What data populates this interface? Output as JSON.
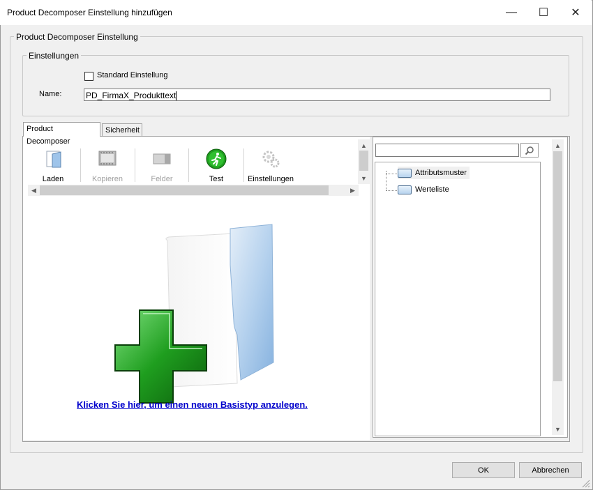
{
  "window": {
    "title": "Product Decomposer Einstellung hinzufügen",
    "minimize_glyph": "—",
    "maximize_glyph": "☐",
    "close_glyph": "✕"
  },
  "outer_group": {
    "legend": "Product Decomposer Einstellung"
  },
  "settings_group": {
    "legend": "Einstellungen",
    "standard_checkbox": {
      "label": "Standard Einstellung",
      "checked": false
    },
    "name_label": "Name:",
    "name_value": "PD_FirmaX_Produkttext"
  },
  "tabs": [
    {
      "label": "Product Decomposer",
      "active": true
    },
    {
      "label": "Sicherheit",
      "active": false
    }
  ],
  "toolbar": {
    "items": [
      {
        "label": "Laden",
        "icon": "folder-open-icon",
        "enabled": true
      },
      {
        "label": "Kopieren",
        "icon": "copy-film-icon",
        "enabled": false
      },
      {
        "label": "Felder",
        "icon": "fields-icon",
        "enabled": false
      },
      {
        "label": "Test",
        "icon": "running-man-icon",
        "enabled": true
      },
      {
        "label": "Einstellungen",
        "icon": "gears-icon",
        "enabled": true
      }
    ]
  },
  "main": {
    "create_link": "Klicken Sie hier, um einen neuen Basistyp anzulegen."
  },
  "tree": {
    "search_placeholder": "",
    "items": [
      {
        "label": "Attributsmuster",
        "selected": true
      },
      {
        "label": "Werteliste",
        "selected": false
      }
    ]
  },
  "buttons": {
    "ok": "OK",
    "cancel": "Abbrechen"
  },
  "colors": {
    "link": "#0000cc",
    "plus_green": "#1f9e1f",
    "folder_blue": "#9cc3ea"
  }
}
